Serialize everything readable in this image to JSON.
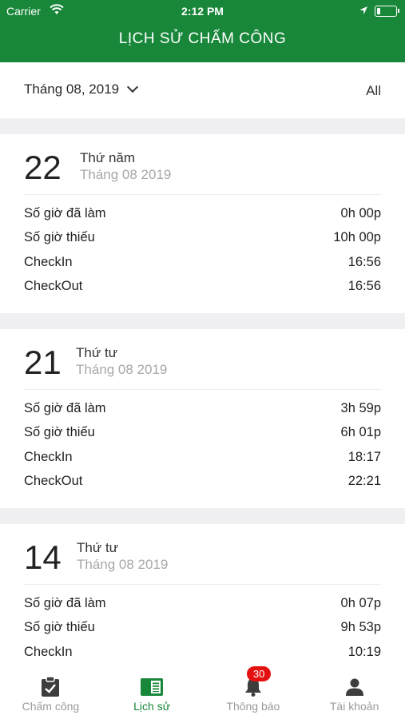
{
  "status": {
    "carrier": "Carrier",
    "time": "2:12 PM",
    "battery_level": 0.2
  },
  "header": {
    "title": "LỊCH SỬ CHẤM CÔNG"
  },
  "filter": {
    "month": "Tháng 08, 2019",
    "all": "All"
  },
  "cards": [
    {
      "day": "22",
      "weekday": "Thứ năm",
      "month": "Tháng 08 2019",
      "rows": [
        {
          "label": "Số giờ đã làm",
          "value": "0h 00p"
        },
        {
          "label": "Số giờ thiếu",
          "value": "10h 00p"
        },
        {
          "label": "CheckIn",
          "value": "16:56"
        },
        {
          "label": "CheckOut",
          "value": "16:56"
        }
      ]
    },
    {
      "day": "21",
      "weekday": "Thứ tư",
      "month": "Tháng 08 2019",
      "rows": [
        {
          "label": "Số giờ đã làm",
          "value": "3h 59p"
        },
        {
          "label": "Số giờ thiếu",
          "value": "6h 01p"
        },
        {
          "label": "CheckIn",
          "value": "18:17"
        },
        {
          "label": "CheckOut",
          "value": "22:21"
        }
      ]
    },
    {
      "day": "14",
      "weekday": "Thứ tư",
      "month": "Tháng 08 2019",
      "rows": [
        {
          "label": "Số giờ đã làm",
          "value": "0h 07p"
        },
        {
          "label": "Số giờ thiếu",
          "value": "9h 53p"
        },
        {
          "label": "CheckIn",
          "value": "10:19"
        }
      ]
    }
  ],
  "tabs": [
    {
      "label": "Chấm công",
      "icon": "clipboard-check-icon"
    },
    {
      "label": "Lịch sử",
      "icon": "history-book-icon",
      "active": true
    },
    {
      "label": "Thông báo",
      "icon": "bell-icon",
      "badge": "30"
    },
    {
      "label": "Tài khoản",
      "icon": "user-icon"
    }
  ],
  "colors": {
    "primary": "#18873a",
    "badge": "#e41010",
    "background": "#f0f0f3"
  }
}
